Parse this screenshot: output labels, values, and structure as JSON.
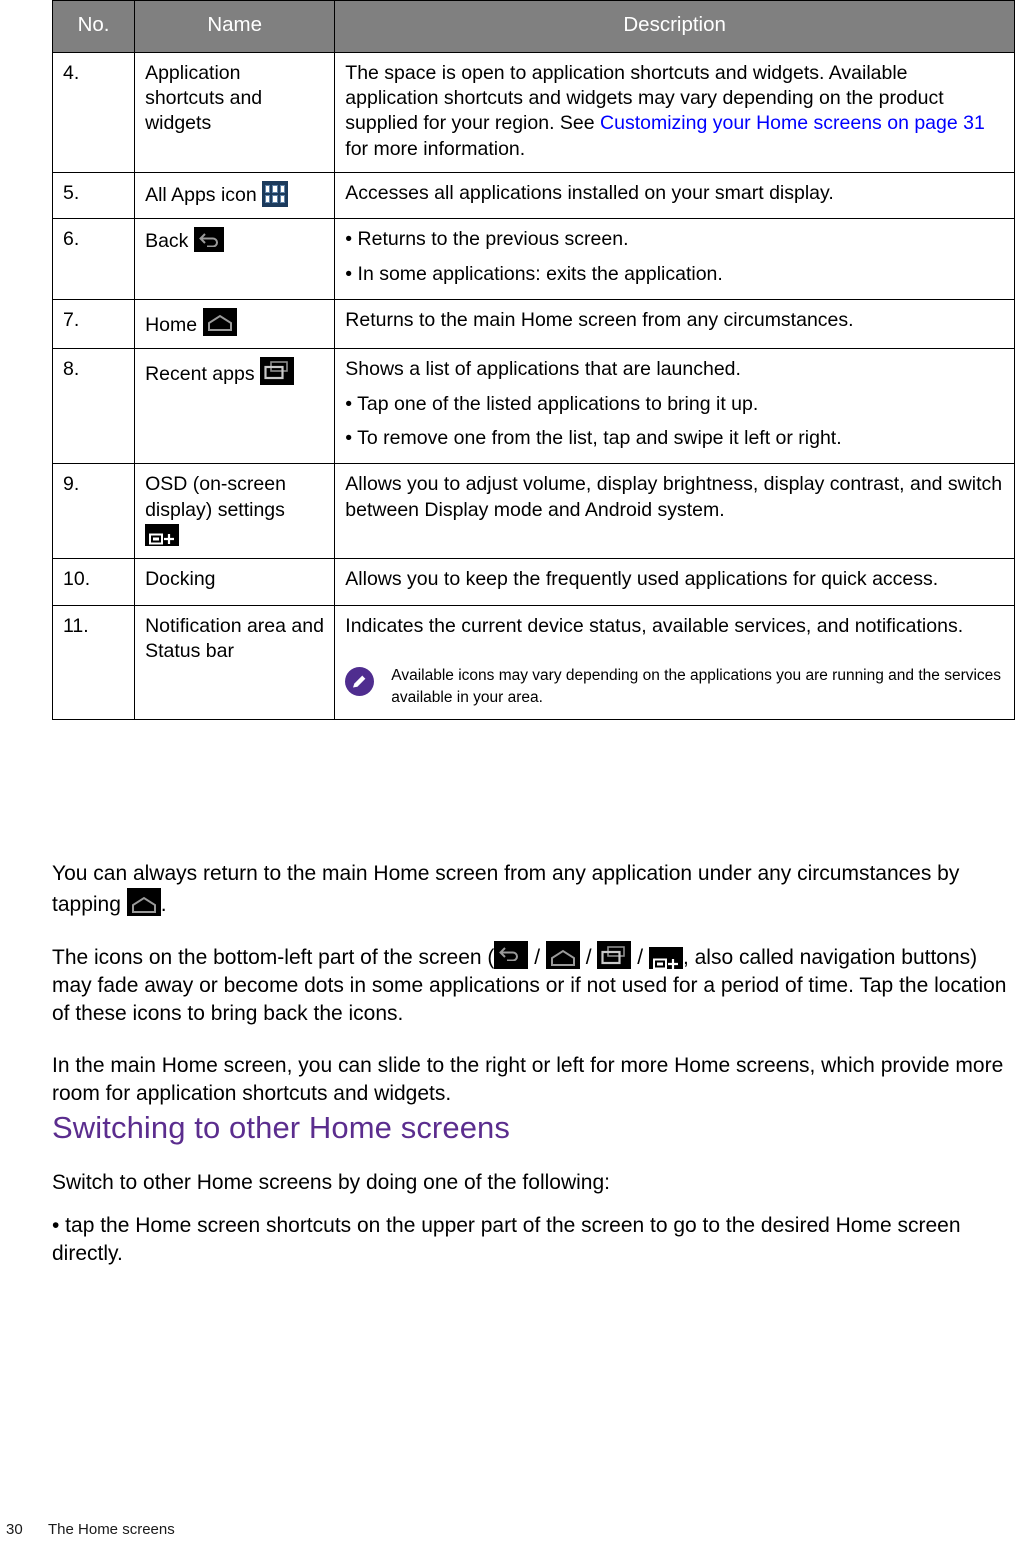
{
  "table": {
    "headers": [
      "No.",
      "Name",
      "Description"
    ],
    "rows": [
      {
        "no": "4.",
        "name": "Application shortcuts and widgets",
        "name_icon": "",
        "desc_pre": "The space is open to application shortcuts and widgets. Available application shortcuts and widgets may vary depending on the product supplied for your region. See ",
        "desc_link": "Customizing your Home screens on page 31",
        "desc_post": " for more information."
      },
      {
        "no": "5.",
        "name": "All Apps icon",
        "name_icon": "all-apps-icon",
        "desc_lines": [
          "Accesses all applications installed on your smart display."
        ]
      },
      {
        "no": "6.",
        "name": "Back",
        "name_icon": "back-icon",
        "desc_lines": [
          "• Returns to the previous screen.",
          "• In some applications: exits the application."
        ]
      },
      {
        "no": "7.",
        "name": "Home",
        "name_icon": "home-icon",
        "desc_lines": [
          "Returns to the main Home screen from any circumstances."
        ]
      },
      {
        "no": "8.",
        "name": "Recent apps",
        "name_icon": "recent-apps-icon",
        "desc_lines": [
          "Shows a list of applications that are launched.",
          "• Tap one of the listed applications to bring it up.",
          "• To remove one from the list, tap and swipe it left or right."
        ]
      },
      {
        "no": "9.",
        "name": "OSD (on-screen display) settings",
        "name_icon": "osd-settings-icon",
        "desc_lines": [
          "Allows you to adjust volume, display brightness, display contrast, and switch between Display mode and Android system."
        ]
      },
      {
        "no": "10.",
        "name": "Docking",
        "name_icon": "",
        "desc_lines": [
          "Allows you to keep the frequently used applications for quick access."
        ]
      },
      {
        "no": "11.",
        "name": "Notification area and Status bar",
        "name_icon": "",
        "desc_lines": [
          "Indicates the current device status, available services, and notifications."
        ],
        "note": "Available icons may vary depending on the applications you are running and the services available in your area."
      }
    ]
  },
  "body": {
    "p1_a": "You can always return to the main Home screen from any application under any circumstances by tapping ",
    "p1_b": ".",
    "p2_a": "The icons on the bottom-left part of the screen (",
    "p2_sep": " / ",
    "p2_b": ", also called navigation buttons) may fade away or become dots in some applications or if not used for a period of time. Tap the location of these icons to bring back the icons.",
    "p3": "In the main Home screen, you can slide to the right or left for more Home screens, which provide more room for application shortcuts and widgets.",
    "section_heading": "Switching to other Home screens",
    "p4": "Switch to other Home screens by doing one of the following:",
    "p5": "• tap the Home screen shortcuts on the upper part of the screen to go to the desired Home screen directly."
  },
  "footer": {
    "page_number": "30",
    "section_title": "The Home screens"
  },
  "colors": {
    "header_bg": "#808080",
    "heading_purple": "#5b2d8e",
    "link_blue": "#0000ff",
    "note_icon_purple": "#4f2d8f",
    "apps_icon_blue": "#1b3a5c"
  }
}
